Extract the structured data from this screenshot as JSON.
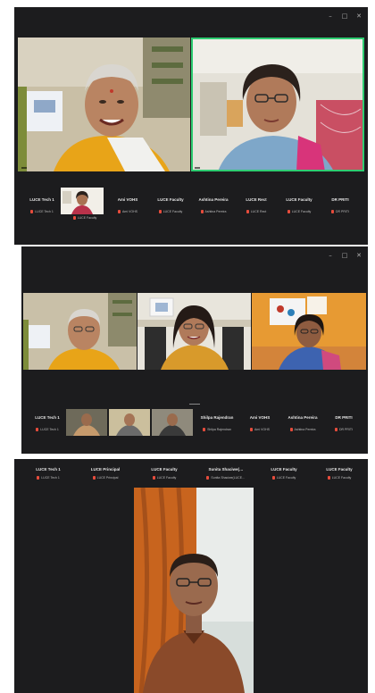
{
  "accent": "#2ecc71",
  "mic_muted_color": "#e74c3c",
  "icons": [
    "minimize-icon",
    "maximize-icon",
    "close-icon",
    "mic-muted-icon"
  ],
  "window_controls": {
    "minimize": "–",
    "maximize": "□",
    "close": "✕"
  },
  "panel1": {
    "strip": [
      {
        "name": "LUCE Tech 1",
        "sub": "LUCE Tech 1"
      },
      {
        "name": "",
        "sub": "LUCE Faculty"
      },
      {
        "name": "Ami VOHS",
        "sub": "Ami VOHS"
      },
      {
        "name": "LUCE Faculty",
        "sub": "LUCE Faculty"
      },
      {
        "name": "Ashtina Pereira",
        "sub": "Ashtina Pereira"
      },
      {
        "name": "LUCE Rect",
        "sub": "LUCE Rect"
      },
      {
        "name": "LUCE Faculty",
        "sub": "LUCE Faculty"
      },
      {
        "name": "DR PRITI",
        "sub": "DR PRITI"
      }
    ]
  },
  "panel2": {
    "strip": [
      {
        "name": "LUCE Tech 1",
        "sub": "LUCE Tech 1"
      },
      {
        "name": "Shilpa Rajendran",
        "sub": "Shilpa Rajendran"
      },
      {
        "name": "Ami VOHS",
        "sub": "Ami VOHS"
      },
      {
        "name": "Ashtina Pereira",
        "sub": "Ashtina Pereira"
      },
      {
        "name": "DR PRITI",
        "sub": "DR PRITI"
      }
    ]
  },
  "panel3": {
    "strip": [
      {
        "name": "LUCE Tech 1",
        "sub": "LUCE Tech 1"
      },
      {
        "name": "LUCE Principal",
        "sub": "LUCE Principal"
      },
      {
        "name": "LUCE Faculty",
        "sub": "LUCE Faculty"
      },
      {
        "name": "Sunita Shaciwe(…",
        "sub": "Sunita Shaciwe(LUCE…"
      },
      {
        "name": "LUCE Faculty",
        "sub": "LUCE Faculty"
      },
      {
        "name": "LUCE Faculty",
        "sub": "LUCE Faculty"
      }
    ]
  }
}
